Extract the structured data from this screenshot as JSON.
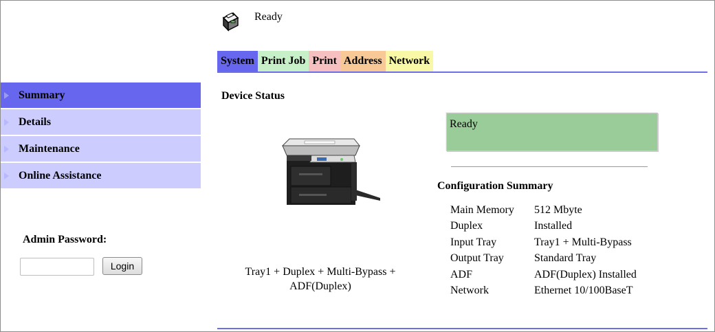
{
  "header": {
    "status_icon": "printer-status-icon",
    "status": "Ready"
  },
  "tabs": [
    {
      "label": "System",
      "color": "#6666ee"
    },
    {
      "label": "Print Job",
      "color": "#c8f0c8"
    },
    {
      "label": "Print",
      "color": "#f6c0c0"
    },
    {
      "label": "Address",
      "color": "#f8c896"
    },
    {
      "label": "Network",
      "color": "#f8f8a6"
    }
  ],
  "sidebar": {
    "items": [
      {
        "label": "Summary",
        "active": true
      },
      {
        "label": "Details",
        "active": false
      },
      {
        "label": "Maintenance",
        "active": false
      },
      {
        "label": "Online Assistance",
        "active": false
      }
    ],
    "admin_label": "Admin Password:",
    "password_value": "",
    "login_label": "Login"
  },
  "main": {
    "section_title": "Device Status",
    "device_icon": "printer-device-image",
    "device_caption": "Tray1 + Duplex + Multi-Bypass + ADF(Duplex)",
    "status_box": {
      "text": "Ready",
      "color": "#99cc99"
    },
    "config": {
      "title": "Configuration Summary",
      "rows": [
        {
          "key": "Main Memory",
          "value": "512 Mbyte"
        },
        {
          "key": "Duplex",
          "value": "Installed"
        },
        {
          "key": "Input Tray",
          "value": "Tray1 + Multi-Bypass"
        },
        {
          "key": "Output Tray",
          "value": "Standard Tray"
        },
        {
          "key": "ADF",
          "value": "ADF(Duplex) Installed"
        },
        {
          "key": "Network",
          "value": "Ethernet 10/100BaseT"
        }
      ]
    }
  },
  "colors": {
    "accent": "#6666ee",
    "menu_bg": "#ccccff",
    "rule": "#6d6de8"
  }
}
